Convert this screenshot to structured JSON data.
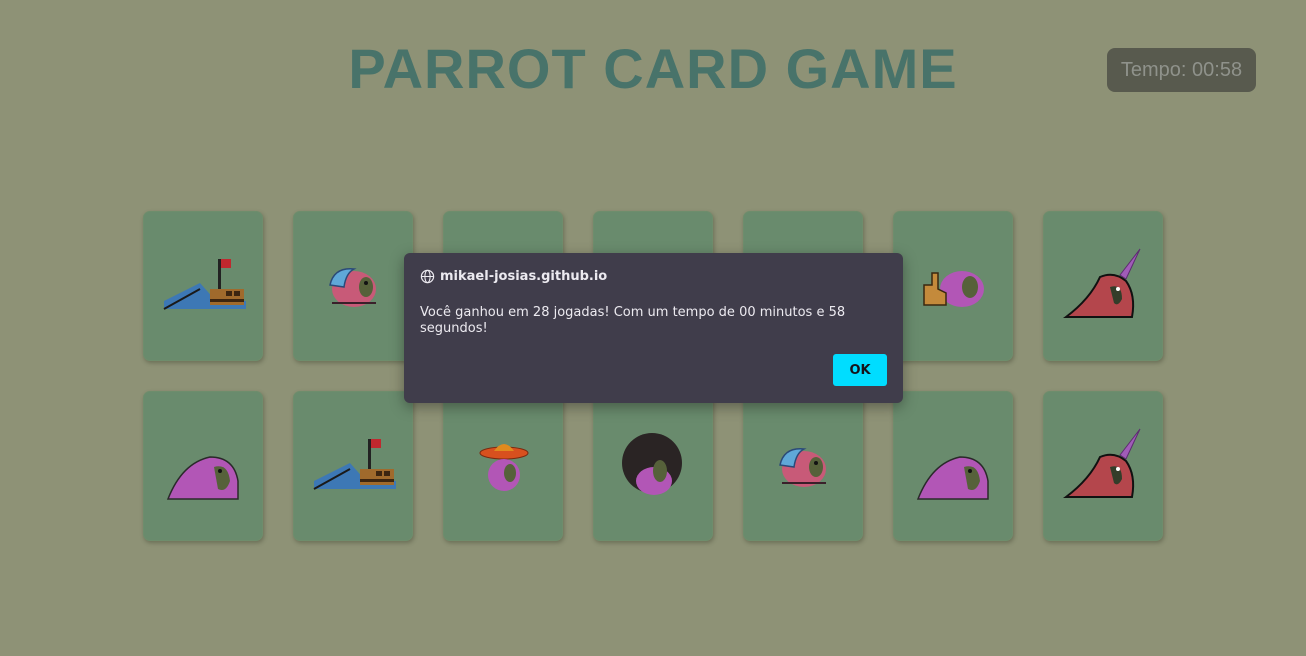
{
  "header": {
    "title": "PARROT CARD GAME"
  },
  "timer": {
    "text": "Tempo: 00:58"
  },
  "cards": [
    {
      "row": 1,
      "icon": "pirate-ship-parrot-icon"
    },
    {
      "row": 1,
      "icon": "parrot-with-cap-icon"
    },
    {
      "row": 1,
      "icon": "hidden-card"
    },
    {
      "row": 1,
      "icon": "hidden-card"
    },
    {
      "row": 1,
      "icon": "hidden-card"
    },
    {
      "row": 1,
      "icon": "parrot-with-hand-icon"
    },
    {
      "row": 1,
      "icon": "unicorn-parrot-icon"
    },
    {
      "row": 2,
      "icon": "big-parrot-icon"
    },
    {
      "row": 2,
      "icon": "pirate-ship-parrot-icon"
    },
    {
      "row": 2,
      "icon": "sombrero-parrot-icon"
    },
    {
      "row": 2,
      "icon": "afro-parrot-icon"
    },
    {
      "row": 2,
      "icon": "parrot-with-cap-icon"
    },
    {
      "row": 2,
      "icon": "big-parrot-icon"
    },
    {
      "row": 2,
      "icon": "unicorn-parrot-icon"
    }
  ],
  "dialog": {
    "origin": "mikael-josias.github.io",
    "message": "Você ganhou em 28 jogadas! Com um tempo de 00 minutos e 58 segundos!",
    "ok_label": "OK",
    "ok_color": "#00ddff"
  },
  "colors": {
    "background": "#8e9276",
    "card": "#698b6d",
    "title": "#48736a"
  }
}
